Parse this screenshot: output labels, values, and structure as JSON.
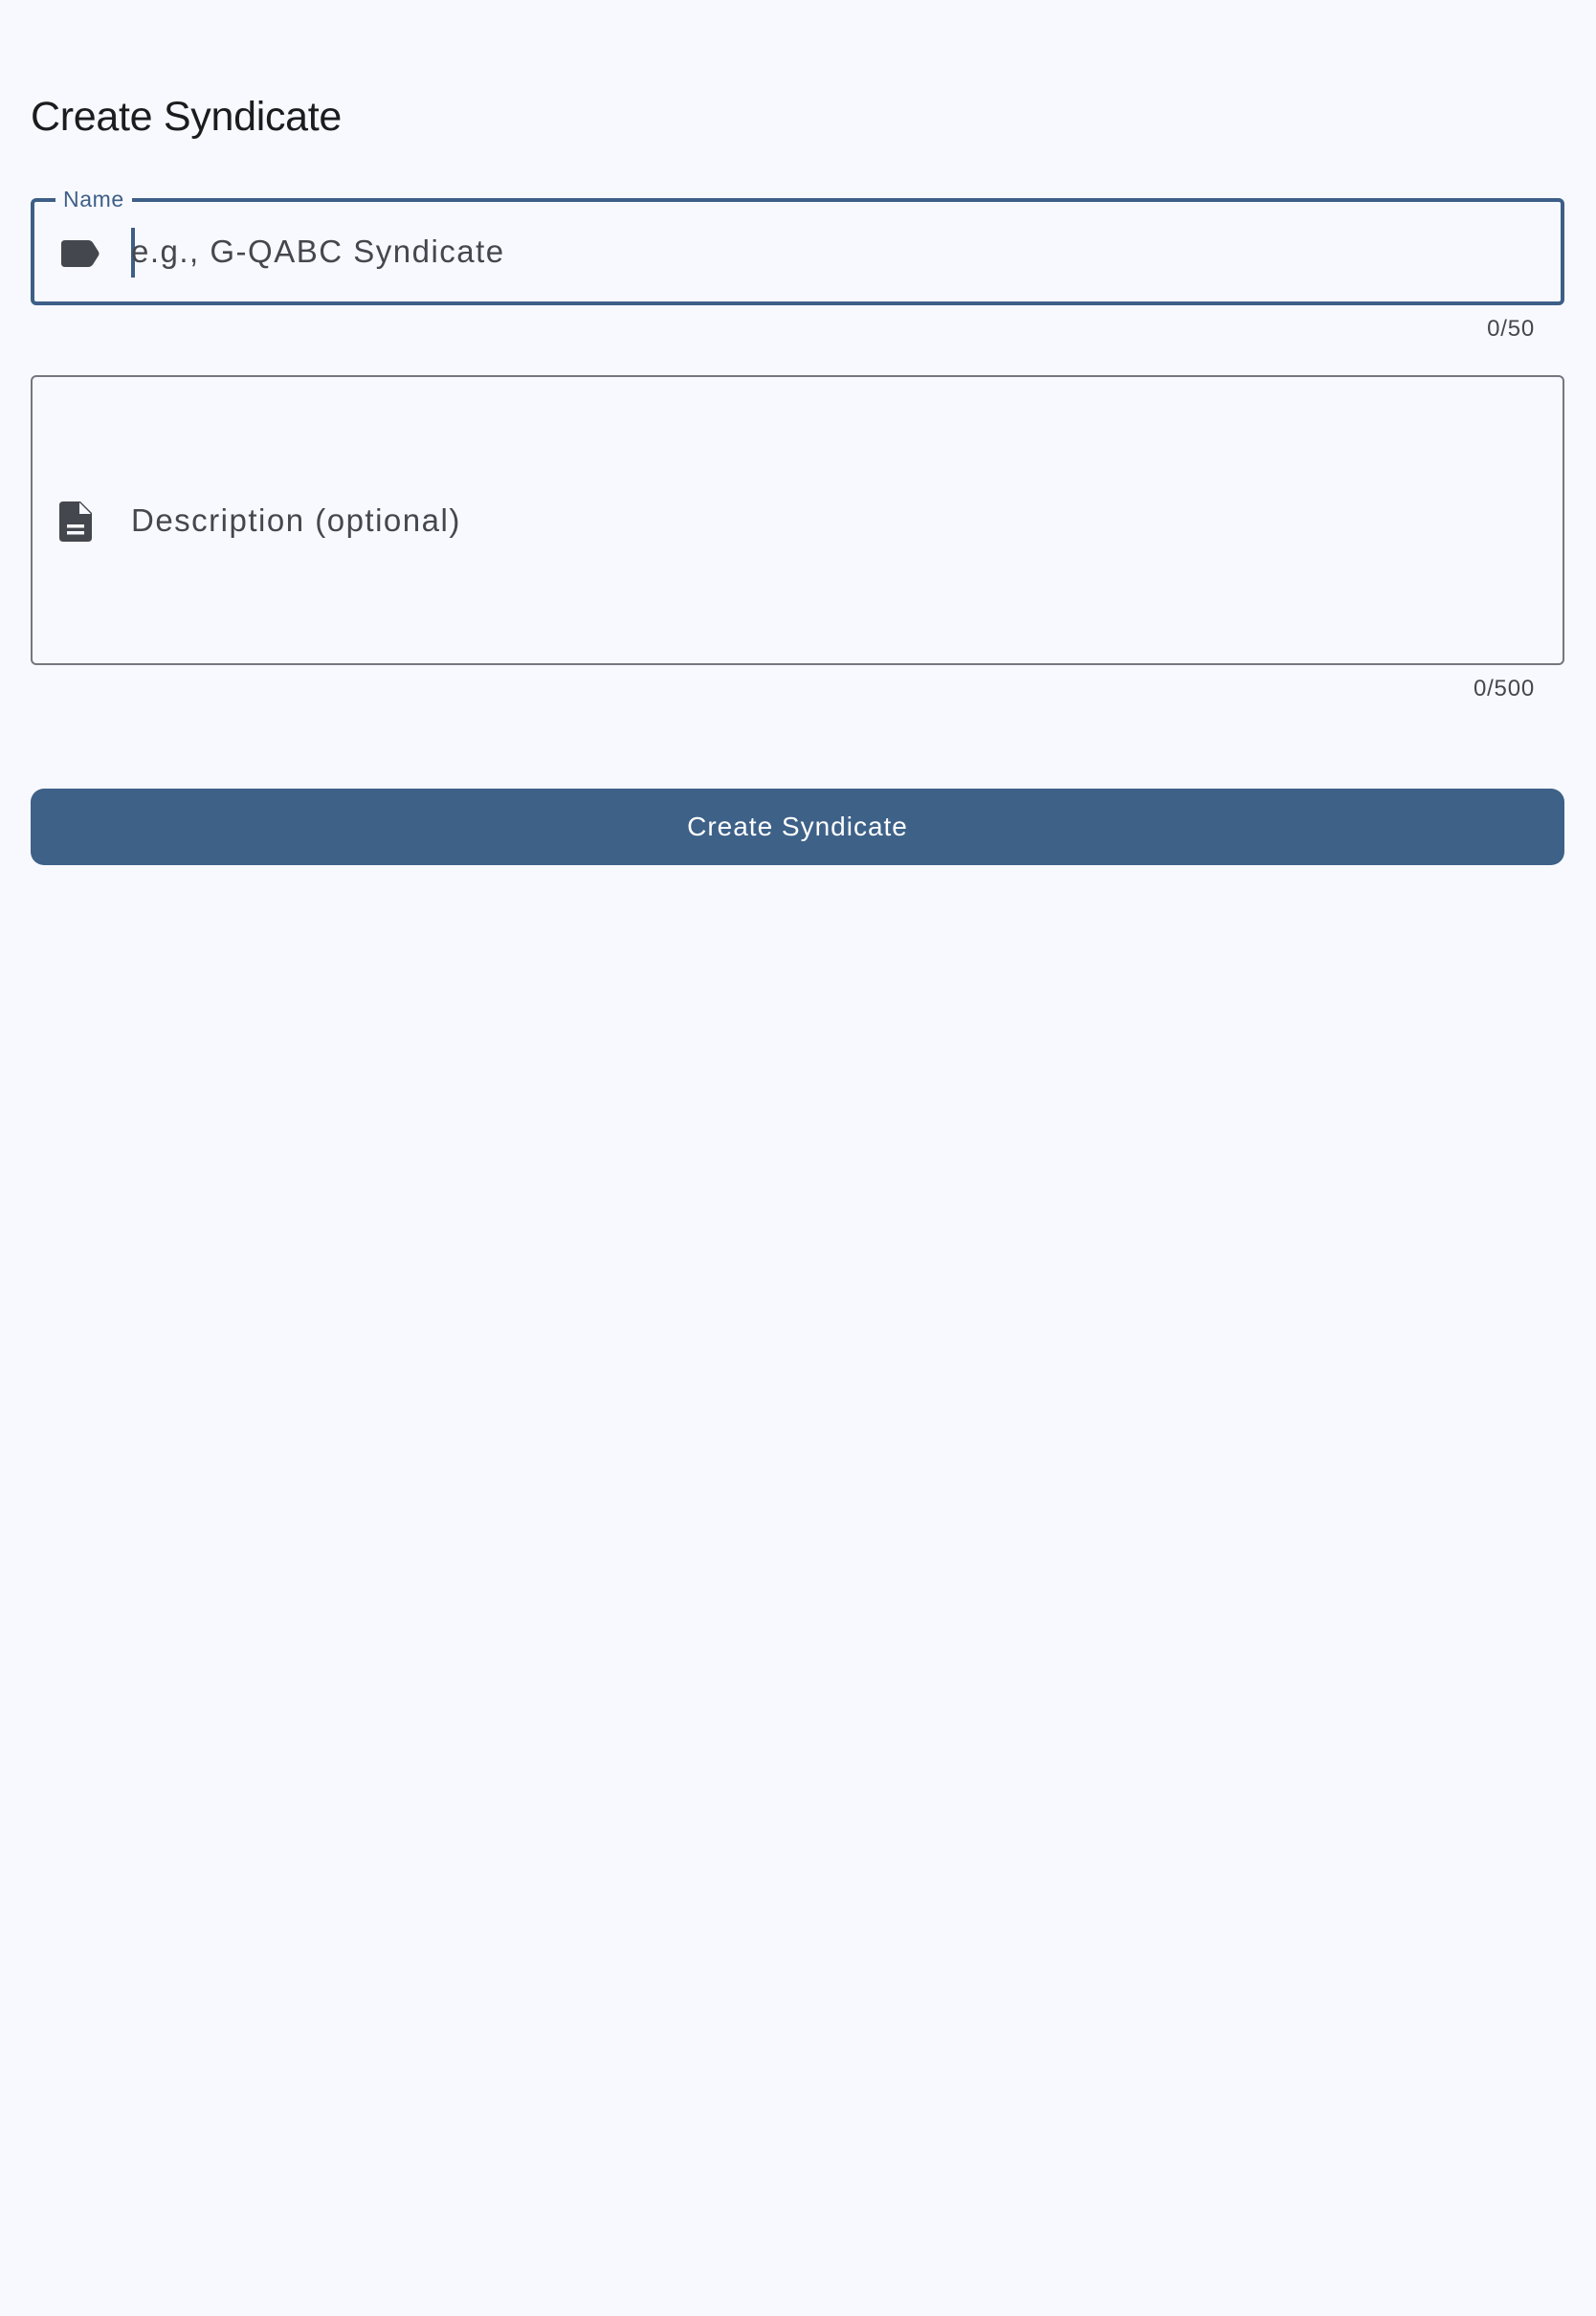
{
  "page": {
    "title": "Create Syndicate"
  },
  "form": {
    "name": {
      "label": "Name",
      "icon": "label-icon",
      "value": "",
      "placeholder": "e.g., G-QABC Syndicate",
      "counter": "0/50"
    },
    "description": {
      "icon": "description-icon",
      "value": "",
      "placeholder": "Description (optional)",
      "counter": "0/500"
    },
    "submit_label": "Create Syndicate"
  },
  "colors": {
    "background": "#f8f9fe",
    "primary": "#3e6188",
    "focused_outline": "#3d5f87",
    "outline": "#74777f",
    "icon": "#44474e",
    "text": "#1a1c1e"
  }
}
